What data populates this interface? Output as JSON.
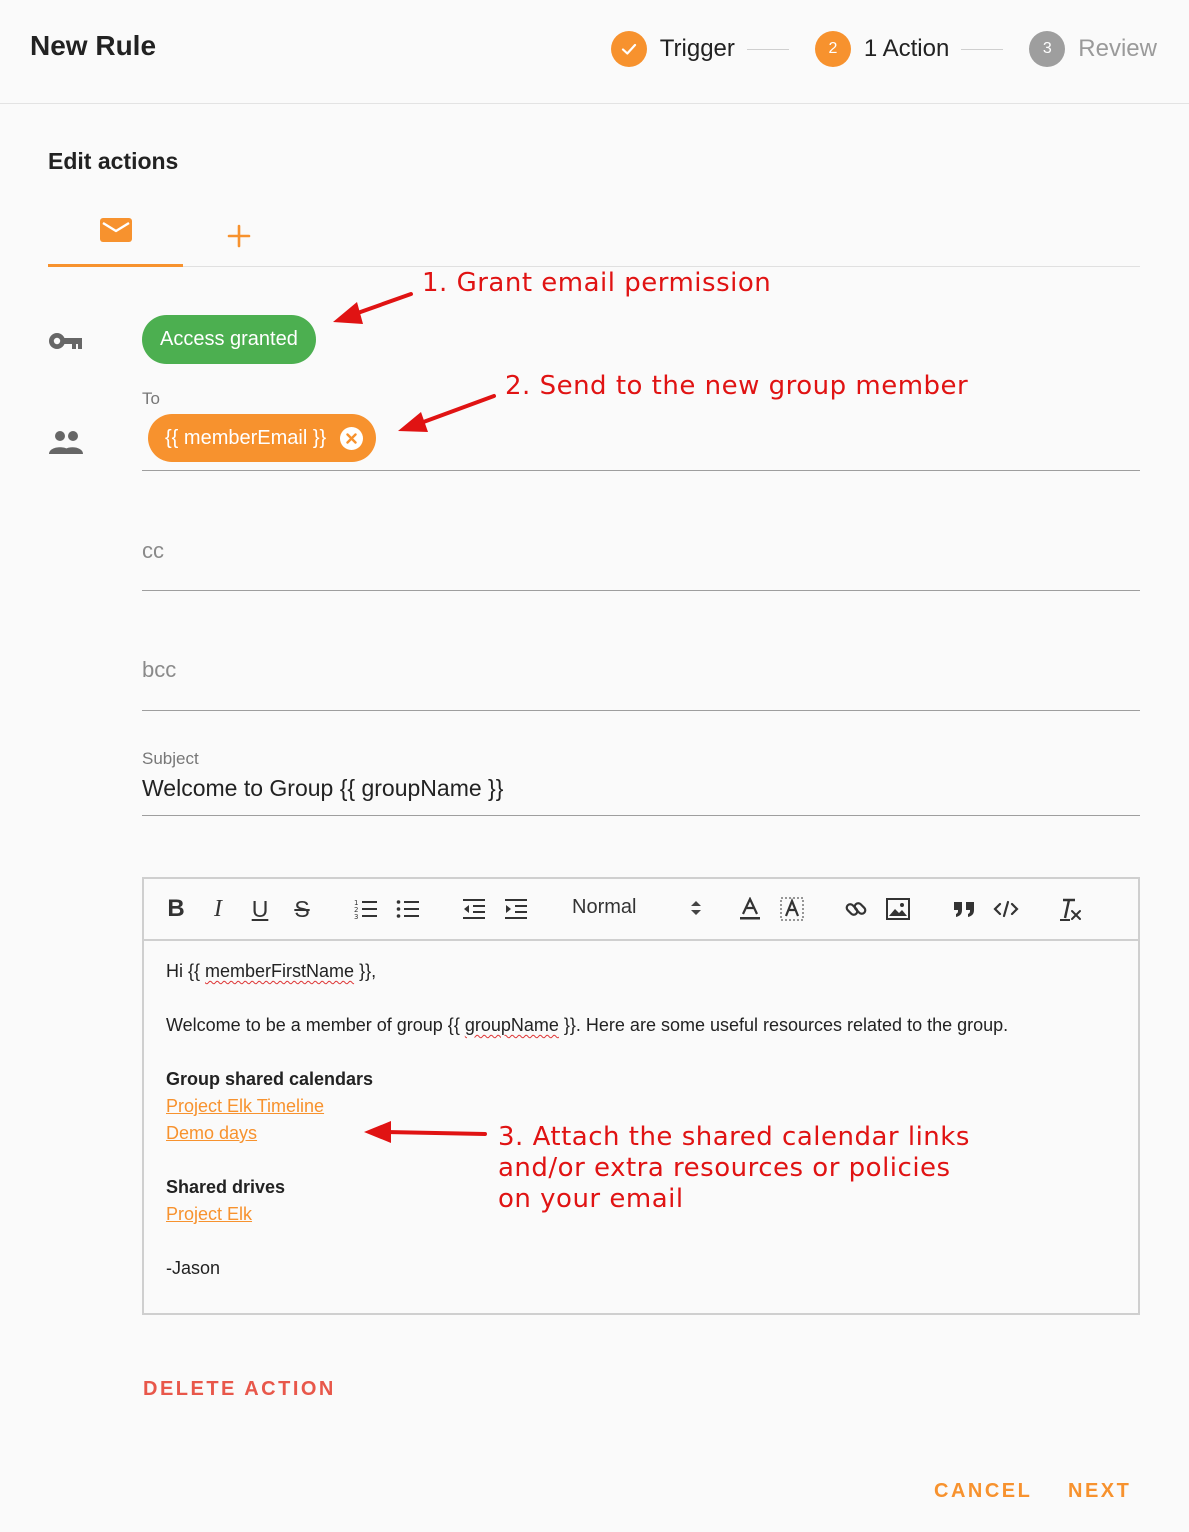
{
  "header": {
    "title": "New Rule",
    "steps": [
      {
        "label": "Trigger",
        "state": "complete"
      },
      {
        "number": "2",
        "label": "1 Action",
        "state": "active"
      },
      {
        "number": "3",
        "label": "Review",
        "state": "pending"
      }
    ]
  },
  "section_title": "Edit actions",
  "tabs": [
    {
      "icon": "mail-icon",
      "selected": true
    },
    {
      "icon": "plus-icon",
      "selected": false
    }
  ],
  "permission": {
    "icon": "key-icon",
    "chip_label": "Access granted"
  },
  "to": {
    "icon": "people-icon",
    "label": "To",
    "chip_value": "{{ memberEmail }}"
  },
  "cc": {
    "placeholder": "cc"
  },
  "bcc": {
    "placeholder": "bcc"
  },
  "subject": {
    "label": "Subject",
    "value": "Welcome to Group {{ groupName }}"
  },
  "editor": {
    "toolbar": {
      "text_size": "Normal"
    },
    "greeting_pre": "Hi {{ ",
    "greeting_var": "memberFirstName",
    "greeting_post": " }},",
    "welcome_pre": "Welcome to be a member of group {{ ",
    "welcome_var": "groupName",
    "welcome_post": " }}. Here are some useful resources related to the group.",
    "calendars_heading": "Group shared calendars",
    "calendar_links": [
      "Project Elk Timeline",
      "Demo days"
    ],
    "drives_heading": "Shared drives",
    "drive_links": [
      "Project Elk"
    ],
    "signature": "-Jason"
  },
  "annotations": {
    "a1": "1. Grant email permission",
    "a2": "2. Send to the new group member",
    "a3_l1": "3. Attach the shared calendar links",
    "a3_l2": "and/or extra resources or policies",
    "a3_l3": "on your email"
  },
  "actions": {
    "delete": "DELETE ACTION",
    "cancel": "CANCEL",
    "next": "NEXT"
  },
  "colors": {
    "accent": "#f7922e",
    "granted": "#4caf50",
    "danger": "#e8574a",
    "annotation": "#e01313"
  }
}
